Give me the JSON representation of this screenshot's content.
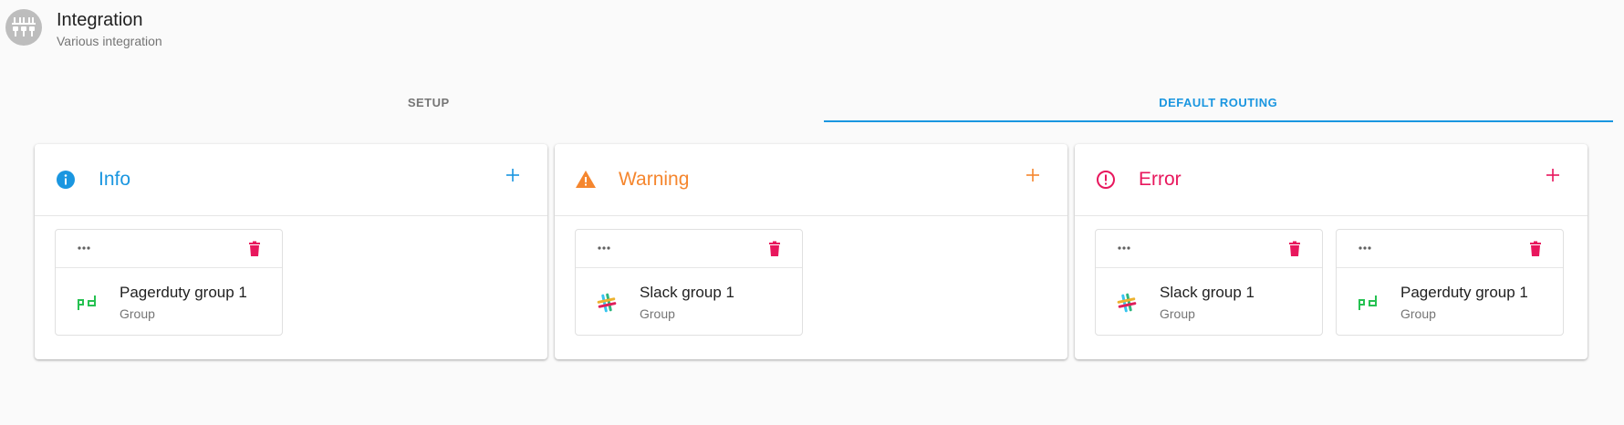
{
  "header": {
    "title": "Integration",
    "subtitle": "Various integration",
    "icon": "integration-plugs-icon"
  },
  "tabs": [
    {
      "label": "SETUP",
      "active": false
    },
    {
      "label": "DEFAULT ROUTING",
      "active": true
    }
  ],
  "colors": {
    "accent": "#1a96e0",
    "info": "#1a96e0",
    "warning": "#f5862e",
    "error": "#e8175d",
    "pagerduty": "#25c151"
  },
  "panels": [
    {
      "title": "Info",
      "icon": "info-icon",
      "cards": [
        {
          "name": "Pagerduty group 1",
          "type": "Group",
          "logo": "pagerduty-logo"
        }
      ]
    },
    {
      "title": "Warning",
      "icon": "warning-icon",
      "cards": [
        {
          "name": "Slack group 1",
          "type": "Group",
          "logo": "slack-logo"
        }
      ]
    },
    {
      "title": "Error",
      "icon": "error-icon",
      "cards": [
        {
          "name": "Slack group 1",
          "type": "Group",
          "logo": "slack-logo"
        },
        {
          "name": "Pagerduty group 1",
          "type": "Group",
          "logo": "pagerduty-logo"
        }
      ]
    }
  ]
}
